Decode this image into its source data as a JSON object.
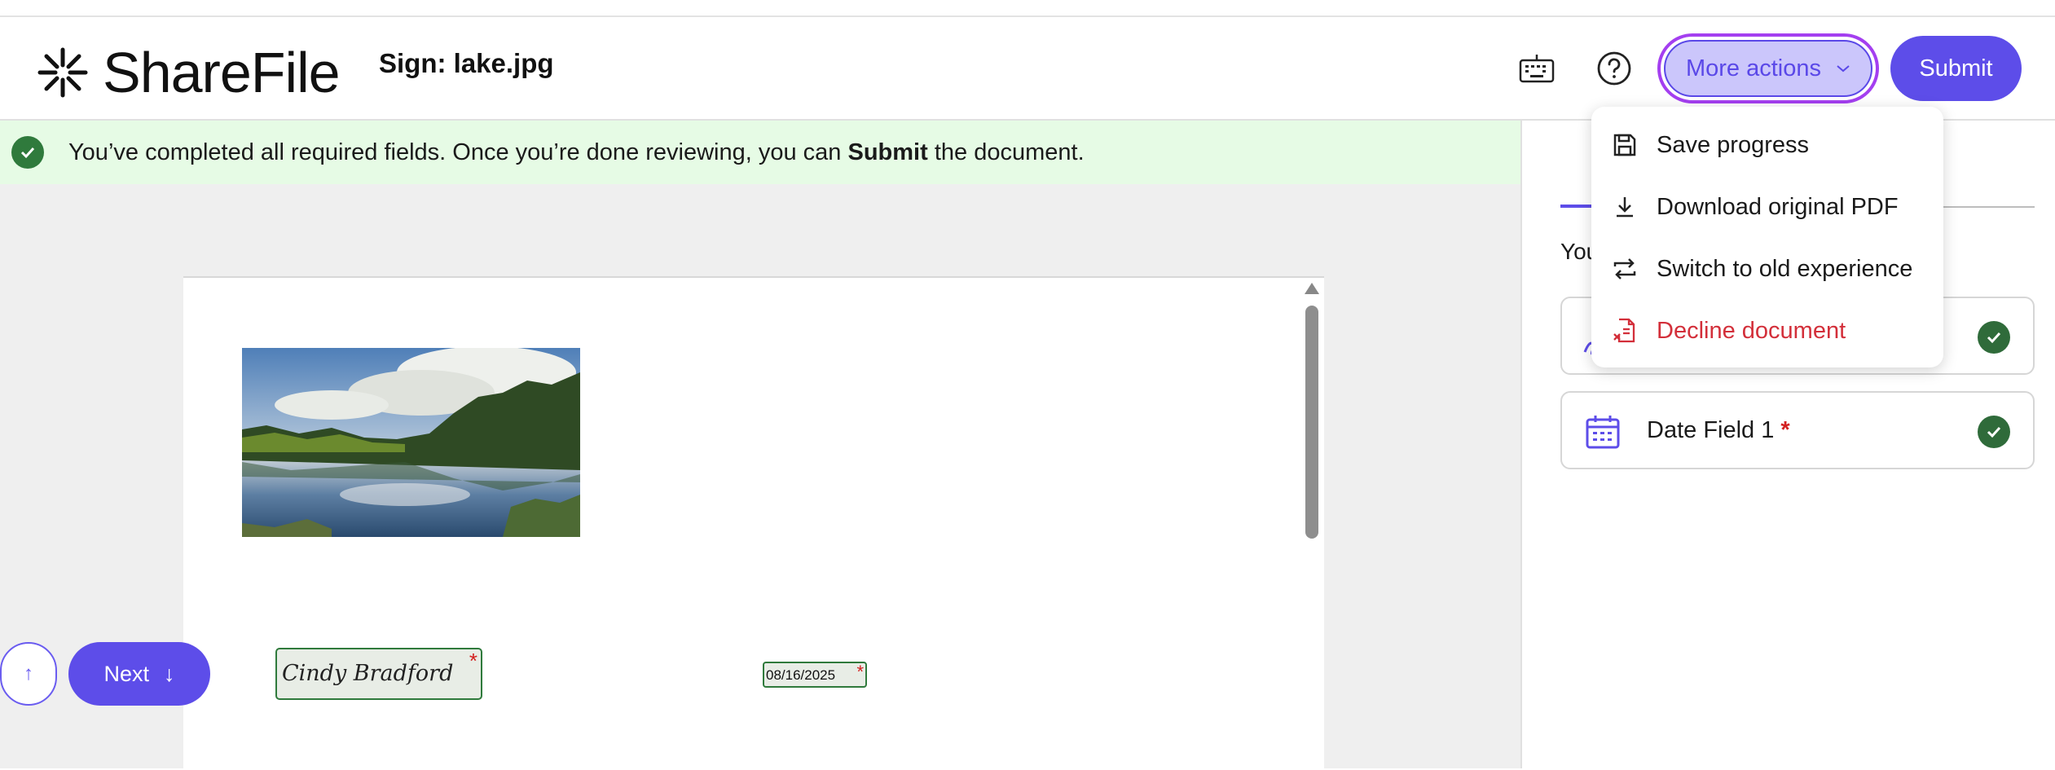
{
  "app": {
    "name": "ShareFile"
  },
  "header": {
    "doc_title": "Sign: lake.jpg",
    "more_actions_label": "More actions",
    "submit_label": "Submit"
  },
  "banner": {
    "text_before": "You’ve completed all required fields. Once you’re done reviewing, you can ",
    "text_bold": "Submit",
    "text_after": " the document."
  },
  "document": {
    "signature_text": "Cindy Bradford",
    "date_value": "08/16/2025",
    "required_marker": "*",
    "next_label": "Next",
    "next_icon": "↓",
    "up_icon": "↑"
  },
  "panel": {
    "intro_text": "You",
    "fields": [
      {
        "label": "",
        "required": false
      },
      {
        "label": "Date Field 1",
        "required": true,
        "required_marker": "*"
      }
    ]
  },
  "menu": {
    "items": [
      {
        "label": "Save progress",
        "icon": "save-icon"
      },
      {
        "label": "Download original PDF",
        "icon": "download-icon"
      },
      {
        "label": "Switch to old experience",
        "icon": "switch-icon"
      },
      {
        "label": "Decline document",
        "icon": "decline-document-icon",
        "danger": true
      }
    ]
  },
  "colors": {
    "accent": "#5d4de9",
    "success": "#2f7a3c",
    "danger": "#d32f3a",
    "banner_bg": "#e6fbe5"
  }
}
